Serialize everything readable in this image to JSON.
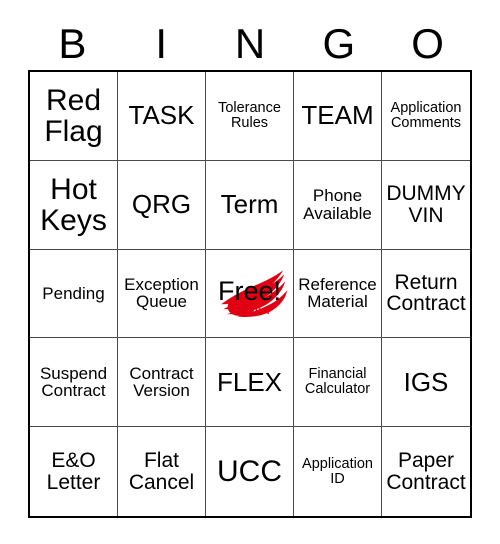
{
  "card": {
    "header_letters": [
      "B",
      "I",
      "N",
      "G",
      "O"
    ],
    "free_space": {
      "label": "Free!",
      "brand_text": "HONDA",
      "logo_icon": "honda-wing-logo",
      "logo_color": "#e00012"
    },
    "colors": {
      "background": "#ffffff",
      "text": "#000000",
      "outer_border": "#000000",
      "inner_border": "#4a4a4a",
      "brand_red": "#e00012"
    },
    "rows": [
      [
        {
          "text": "Red\nFlag",
          "size": "fs-xl"
        },
        {
          "text": "TASK",
          "size": "fs-lg"
        },
        {
          "text": "Tolerance\nRules",
          "size": "fs-xs"
        },
        {
          "text": "TEAM",
          "size": "fs-lg"
        },
        {
          "text": "Application\nComments",
          "size": "fs-xs"
        }
      ],
      [
        {
          "text": "Hot\nKeys",
          "size": "fs-xl"
        },
        {
          "text": "QRG",
          "size": "fs-lg"
        },
        {
          "text": "Term",
          "size": "fs-lg"
        },
        {
          "text": "Phone\nAvailable",
          "size": "fs-sm"
        },
        {
          "text": "DUMMY\nVIN",
          "size": "fs-md"
        }
      ],
      [
        {
          "text": "Pending",
          "size": "fs-sm"
        },
        {
          "text": "Exception\nQueue",
          "size": "fs-sm"
        },
        {
          "text": "Free!",
          "size": "free"
        },
        {
          "text": "Reference\nMaterial",
          "size": "fs-sm"
        },
        {
          "text": "Return\nContract",
          "size": "fs-md"
        }
      ],
      [
        {
          "text": "Suspend\nContract",
          "size": "fs-sm"
        },
        {
          "text": "Contract\nVersion",
          "size": "fs-sm"
        },
        {
          "text": "FLEX",
          "size": "fs-lg"
        },
        {
          "text": "Financial\nCalculator",
          "size": "fs-xs"
        },
        {
          "text": "IGS",
          "size": "fs-lg"
        }
      ],
      [
        {
          "text": "E&O\nLetter",
          "size": "fs-md"
        },
        {
          "text": "Flat\nCancel",
          "size": "fs-md"
        },
        {
          "text": "UCC",
          "size": "fs-xl"
        },
        {
          "text": "Application\nID",
          "size": "fs-xs"
        },
        {
          "text": "Paper\nContract",
          "size": "fs-md"
        }
      ]
    ]
  }
}
